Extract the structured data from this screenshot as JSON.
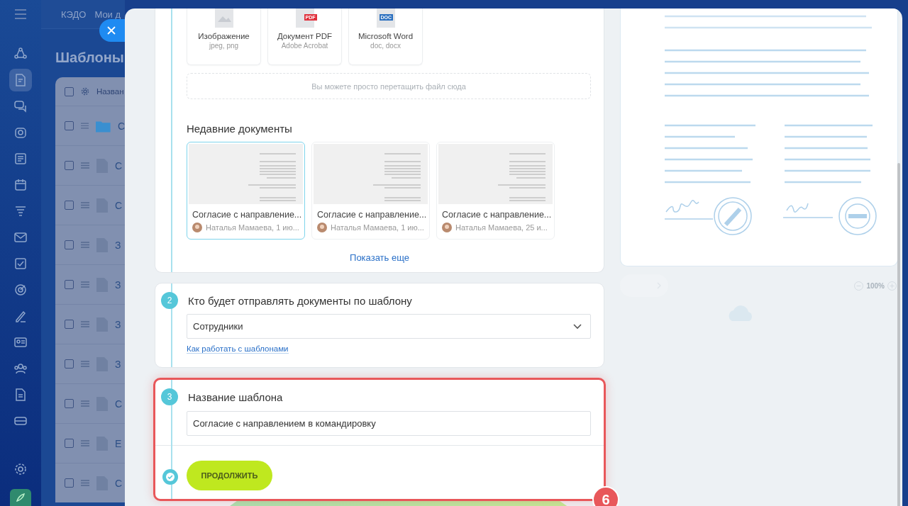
{
  "sidebar": {
    "items": [
      {
        "selected": false
      },
      {
        "selected": true
      },
      {
        "selected": false
      },
      {
        "selected": false
      },
      {
        "selected": false
      },
      {
        "selected": false
      },
      {
        "selected": false
      },
      {
        "selected": false
      },
      {
        "selected": false
      },
      {
        "selected": false
      },
      {
        "selected": false
      },
      {
        "selected": false
      },
      {
        "selected": false
      },
      {
        "selected": false
      },
      {
        "selected": false
      }
    ]
  },
  "top_tabs": [
    "КЭДО",
    "Мои д"
  ],
  "page_title": "Шаблоны",
  "table": {
    "all_checked": false,
    "columns": [
      "Назван"
    ],
    "rows": [
      {
        "kind": "folder",
        "name": "С",
        "checked": false
      },
      {
        "kind": "file",
        "name": "С",
        "checked": false
      },
      {
        "kind": "file",
        "name": "С",
        "checked": false
      },
      {
        "kind": "file",
        "name": "З",
        "checked": false
      },
      {
        "kind": "file",
        "name": "З",
        "checked": false
      },
      {
        "kind": "file",
        "name": "З",
        "checked": false
      },
      {
        "kind": "file",
        "name": "З",
        "checked": false
      },
      {
        "kind": "file",
        "name": "С",
        "checked": false
      },
      {
        "kind": "file",
        "name": "Е",
        "checked": false
      },
      {
        "kind": "file",
        "name": "С",
        "checked": false
      }
    ]
  },
  "file_types": [
    {
      "kind": "image",
      "label": "Изображение",
      "sub": "jpeg, png"
    },
    {
      "kind": "pdf",
      "badge": "PDF",
      "label": "Документ PDF",
      "sub": "Adobe Acrobat"
    },
    {
      "kind": "doc",
      "badge": "DOC",
      "label": "Microsoft Word",
      "sub": "doc, docx"
    }
  ],
  "drop_zone": "Вы можете просто перетащить файл сюда",
  "recent": {
    "title": "Недавние документы",
    "items": [
      {
        "title": "Согласие с направление...",
        "meta": "Наталья Мамаева, 1 ию...",
        "selected": true
      },
      {
        "title": "Согласие с направление...",
        "meta": "Наталья Мамаева, 1 ию...",
        "selected": false
      },
      {
        "title": "Согласие с направление...",
        "meta": "Наталья Мамаева, 25 и...",
        "selected": false
      }
    ],
    "more": "Показать еще"
  },
  "steps": [
    {
      "kind": "select",
      "number": "2",
      "title": "Кто будет отправлять документы по шаблону",
      "value": "Сотрудники",
      "link": "Как работать с шаблонами",
      "highlighted": false
    },
    {
      "kind": "input",
      "number": "3",
      "title": "Название шаблона",
      "value": "Согласие с направлением в командировку",
      "highlighted": true
    }
  ],
  "continue_button": "ПРОДОЛЖИТЬ",
  "callout": "6",
  "preview": {
    "zoom": "100%"
  }
}
